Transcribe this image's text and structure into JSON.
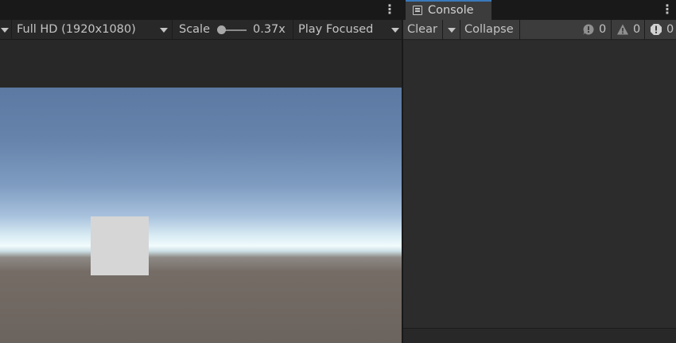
{
  "game_view": {
    "toolbar": {
      "resolution": "Full HD (1920x1080)",
      "scale_label": "Scale",
      "scale_value": "0.37x",
      "scale_fraction": 0.37,
      "play_mode": "Play Focused"
    }
  },
  "console": {
    "tab_label": "Console",
    "toolbar": {
      "clear_label": "Clear",
      "collapse_label": "Collapse",
      "log_count": "0",
      "warning_count": "0",
      "error_count": "0"
    }
  },
  "icons": {
    "kebab": "more-vert-icon",
    "dropdown": "chevron-down-icon",
    "console": "console-icon",
    "info": "info-icon",
    "warning": "warning-icon",
    "error": "error-icon"
  },
  "colors": {
    "panel_bg": "#282828",
    "toolbar_bg": "#3c3c3c",
    "tab_accent": "#3a79bb",
    "text": "#c4c4c4"
  }
}
